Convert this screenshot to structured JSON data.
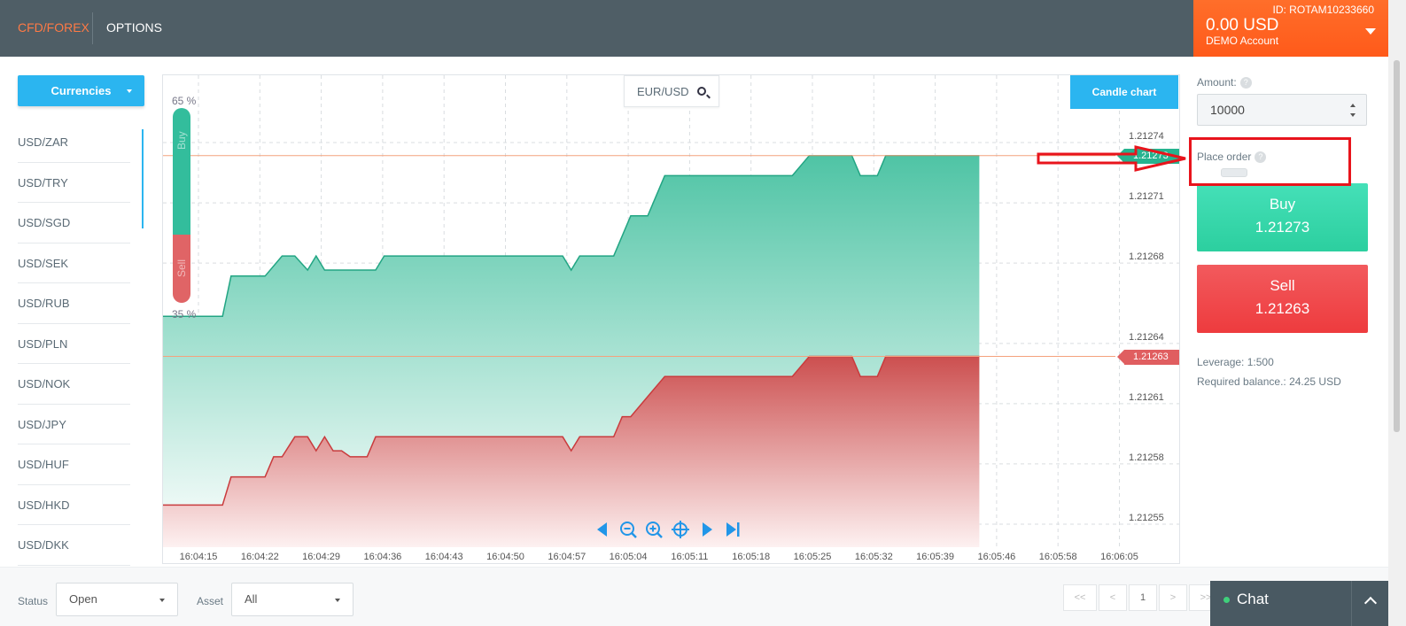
{
  "header": {
    "tabs": [
      {
        "label": "CFD/FOREX",
        "active": true
      },
      {
        "label": "OPTIONS",
        "active": false
      }
    ],
    "account": {
      "id": "ID: ROTAM10233660",
      "balance": "0.00 USD",
      "type": "DEMO Account"
    }
  },
  "sidebar": {
    "category_button": "Currencies",
    "pairs": [
      "USD/ZAR",
      "USD/TRY",
      "USD/SGD",
      "USD/SEK",
      "USD/RUB",
      "USD/PLN",
      "USD/NOK",
      "USD/JPY",
      "USD/HUF",
      "USD/HKD",
      "USD/DKK"
    ]
  },
  "chart": {
    "pair": "EUR/USD",
    "chart_type_button": "Candle chart",
    "sentiment": {
      "buy_pct": "65 %",
      "sell_pct": "35 %",
      "buy_label": "Buy",
      "sell_label": "Sell",
      "buy_fraction": 0.65
    },
    "buy_price_tag": "1.21273",
    "sell_price_tag": "1.21263",
    "controls": [
      "scroll-left-icon",
      "zoom-out-icon",
      "zoom-in-icon",
      "center-icon",
      "scroll-right-icon",
      "jump-to-end-icon"
    ]
  },
  "chart_data": {
    "type": "area",
    "y_tick_labels": [
      "1.21274",
      "1.21271",
      "1.21268",
      "1.21264",
      "1.21261",
      "1.21258",
      "1.21255"
    ],
    "x_tick_labels": [
      "16:04:15",
      "16:04:22",
      "16:04:29",
      "16:04:36",
      "16:04:43",
      "16:04:50",
      "16:04:57",
      "16:05:04",
      "16:05:11",
      "16:05:18",
      "16:05:25",
      "16:05:32",
      "16:05:39",
      "16:05:46",
      "16:05:58",
      "16:06:05"
    ],
    "ylim": [
      1.212535,
      1.21277
    ],
    "xlim": [
      0,
      112
    ],
    "series": [
      {
        "name": "Buy",
        "color": "#33bd9c",
        "x": [
          0,
          7,
          8,
          12,
          14,
          15.5,
          17,
          18,
          19,
          20,
          25,
          26,
          27,
          47,
          48,
          49,
          53,
          55,
          57,
          59,
          60,
          61,
          74,
          76,
          80,
          81,
          82,
          84,
          85,
          86,
          96
        ],
        "y": [
          1.21265,
          1.21265,
          1.21267,
          1.21267,
          1.21268,
          1.21268,
          1.212673,
          1.21268,
          1.212673,
          1.212673,
          1.212673,
          1.21268,
          1.21268,
          1.21268,
          1.212673,
          1.21268,
          1.21268,
          1.2127,
          1.2127,
          1.21272,
          1.21272,
          1.21272,
          1.21272,
          1.21273,
          1.21273,
          1.21273,
          1.21272,
          1.21272,
          1.21273,
          1.21273,
          1.21273
        ]
      },
      {
        "name": "Sell",
        "color": "#e06466",
        "x": [
          0,
          7,
          8,
          12,
          13,
          14,
          15.5,
          17,
          18,
          19,
          20,
          21,
          22,
          24,
          25,
          47,
          48,
          49,
          53,
          54,
          55,
          57,
          59,
          60,
          61,
          74,
          76,
          80,
          81,
          82,
          84,
          85,
          86,
          96
        ],
        "y": [
          1.212556,
          1.212556,
          1.21257,
          1.21257,
          1.21258,
          1.21258,
          1.21259,
          1.21259,
          1.212583,
          1.21259,
          1.212583,
          1.212583,
          1.21258,
          1.21258,
          1.21259,
          1.21259,
          1.212583,
          1.21259,
          1.21259,
          1.2126,
          1.2126,
          1.21261,
          1.21262,
          1.21262,
          1.21262,
          1.21262,
          1.21263,
          1.21263,
          1.21263,
          1.21262,
          1.21262,
          1.21263,
          1.21263,
          1.21263
        ]
      }
    ],
    "grid": true
  },
  "order_panel": {
    "amount_label": "Amount:",
    "amount_value": "10000",
    "place_order_label": "Place order",
    "help_glyph": "?",
    "buy": {
      "label": "Buy",
      "price": "1.21273"
    },
    "sell": {
      "label": "Sell",
      "price": "1.21263"
    },
    "leverage": "Leverage: 1:500",
    "required_balance": "Required balance.: 24.25 USD"
  },
  "bottom": {
    "status_label": "Status",
    "status_value": "Open",
    "asset_label": "Asset",
    "asset_value": "All",
    "pagination": [
      "<<",
      "<",
      "1",
      ">",
      ">>"
    ],
    "chat_label": "Chat"
  },
  "colors": {
    "accent": "#2bb5f0",
    "buy": "#33bd9c",
    "sell": "#e06466",
    "account": "#ff6420",
    "annotation": "#e8141c"
  }
}
